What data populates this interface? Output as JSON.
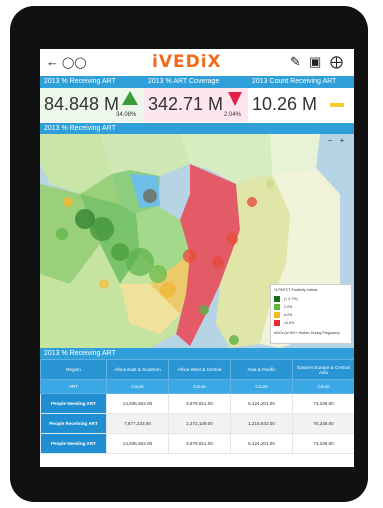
{
  "header": {
    "logo": "iVEDiX",
    "icons": [
      "back-arrow-icon",
      "binoculars-icon",
      "pencil-icon",
      "camera-icon",
      "settings-icon"
    ]
  },
  "kpis": [
    {
      "title": "2013 % Receiving ART",
      "value": "84.848 M",
      "delta": "34.08%",
      "trend": "up",
      "color": "#3a9d3a",
      "bg": "#eaf6e8"
    },
    {
      "title": "2013 % ART Coverage",
      "value": "342.71 M",
      "delta": "2.04%",
      "trend": "down",
      "color": "#e41e4a",
      "bg": "#fde4ea"
    },
    {
      "title": "2013 Count Receiving ART",
      "value": "10.26 M",
      "delta": "",
      "trend": "flat",
      "color": "#f2d02b",
      "bg": "#ffffff"
    }
  ],
  "map": {
    "title": "2013 % Receiving ART",
    "legend": {
      "title": "% PMTCT Positivity Infants",
      "items": [
        {
          "label": "(< 2.7%)",
          "color": "#1b6f1b"
        },
        {
          "label": "2.0%",
          "color": "#5fb43a"
        },
        {
          "label": "6.0%",
          "color": "#f5b81e"
        },
        {
          "label": "10.0%",
          "color": "#e52b2b"
        }
      ],
      "footer": "ANCs (to HIV+ Mother During Pregnancy"
    }
  },
  "table": {
    "title": "2013 % Receiving ART",
    "corner": "Region",
    "subcorner": "ART",
    "columns": [
      "Africa East & Southern",
      "Africa West & Central",
      "Asia & Pacific",
      "Eastern Europe & Central Asia"
    ],
    "subheader": "Count",
    "rows": [
      {
        "label": "People Needing ART",
        "values": [
          "14,935,502.00",
          "4,979,921.00",
          "5,124,201.00",
          "73,239.00"
        ]
      },
      {
        "label": "People Receiving ART",
        "values": [
          "7,677,233.00",
          "1,272,139.00",
          "1,215,642.00",
          "75,348.00"
        ]
      },
      {
        "label": "People Needing ART",
        "values": [
          "14,935,502.00",
          "4,979,921.00",
          "5,124,201.00",
          "73,239.00"
        ]
      }
    ]
  }
}
